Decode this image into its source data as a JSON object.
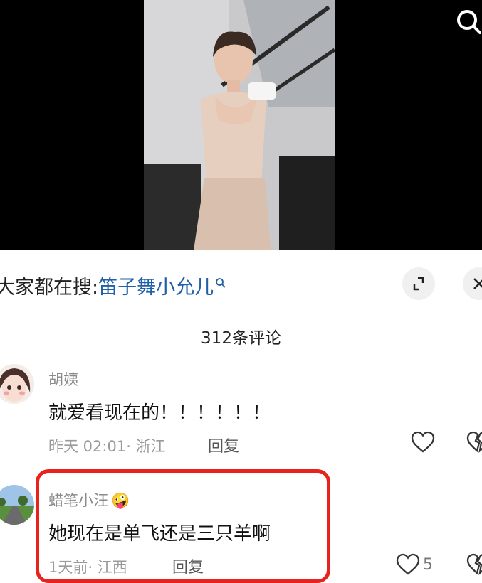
{
  "search_bar": {
    "prefix": "大家都在搜:",
    "term": "笛子舞小允儿"
  },
  "comments_header": {
    "count_label": "312条评论"
  },
  "comments": [
    {
      "user": "胡姨",
      "text": "就爱看现在的！！！！！！",
      "time": "昨天 02:01",
      "location": "· 浙江",
      "reply_label": "回复"
    },
    {
      "user": "蜡笔小汪",
      "emoji": "🤪",
      "text": "她现在是单飞还是三只羊啊",
      "time": "1天前",
      "location": "· 江西",
      "reply_label": "回复",
      "likes": "5"
    }
  ],
  "colors": {
    "highlight_box": "#e8231d",
    "search_term": "#1f5fa8"
  },
  "icons": [
    "search-icon",
    "search-term-icon",
    "expand-icon",
    "close-icon",
    "heart-icon",
    "split-heart-icon"
  ]
}
